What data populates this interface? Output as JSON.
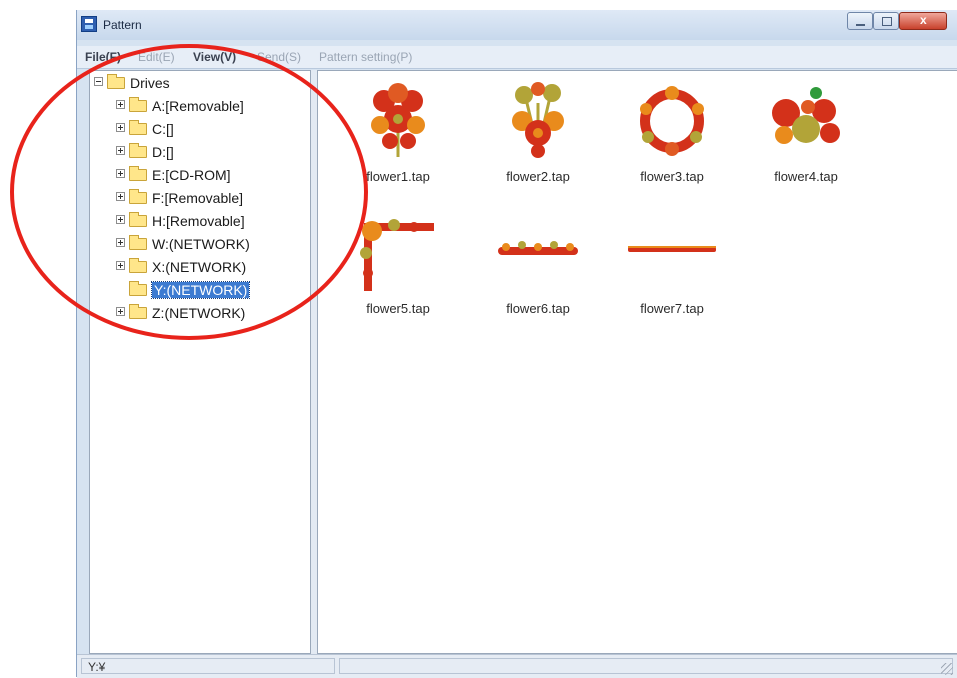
{
  "window": {
    "title": "Pattern"
  },
  "menu": [
    {
      "label": "File(F)",
      "active": true
    },
    {
      "label": "Edit(E)",
      "active": false
    },
    {
      "label": "View(V)",
      "active": true
    },
    {
      "label": "Send(S)",
      "active": false
    },
    {
      "label": "Pattern setting(P)",
      "active": false
    }
  ],
  "tree": {
    "root": "Drives",
    "items": [
      {
        "label": "A:[Removable]"
      },
      {
        "label": "C:[]"
      },
      {
        "label": "D:[]"
      },
      {
        "label": "E:[CD-ROM]"
      },
      {
        "label": "F:[Removable]"
      },
      {
        "label": "H:[Removable]"
      },
      {
        "label": "W:(NETWORK)"
      },
      {
        "label": "X:(NETWORK)"
      },
      {
        "label": "Y:(NETWORK)",
        "selected": true
      },
      {
        "label": "Z:(NETWORK)"
      }
    ]
  },
  "files": [
    {
      "name": "flower1.tap",
      "icon": "flower-bouquet-icon"
    },
    {
      "name": "flower2.tap",
      "icon": "flower-bouquet-icon"
    },
    {
      "name": "flower3.tap",
      "icon": "flower-wreath-icon"
    },
    {
      "name": "flower4.tap",
      "icon": "flower-cluster-icon"
    },
    {
      "name": "flower5.tap",
      "icon": "flower-corner-icon"
    },
    {
      "name": "flower6.tap",
      "icon": "flower-border-icon"
    },
    {
      "name": "flower7.tap",
      "icon": "flower-line-icon"
    }
  ],
  "status": {
    "path": "Y:¥"
  },
  "colors": {
    "annotation": "#e8231b",
    "selection": "#3d7bd1",
    "embroidery_red": "#d3311a",
    "embroidery_orange": "#e98b1c",
    "embroidery_olive": "#b2a438"
  }
}
